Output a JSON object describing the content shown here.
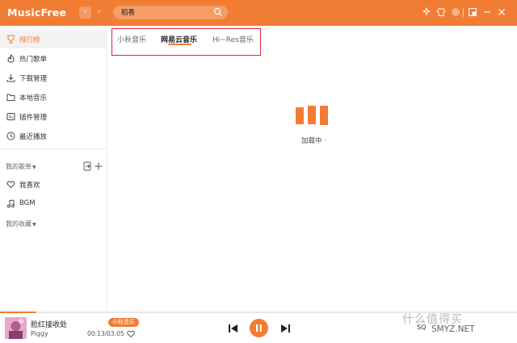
{
  "app": {
    "title": "MusicFree"
  },
  "search": {
    "value": "稻香"
  },
  "sidebar": {
    "items": [
      {
        "label": "排行榜",
        "icon": "trophy-icon",
        "active": true
      },
      {
        "label": "热门歌单",
        "icon": "fire-icon"
      },
      {
        "label": "下载管理",
        "icon": "download-icon"
      },
      {
        "label": "本地音乐",
        "icon": "folder-icon"
      },
      {
        "label": "插件管理",
        "icon": "plugin-icon"
      },
      {
        "label": "最近播放",
        "icon": "clock-icon"
      }
    ],
    "my_playlists_header": "我的歌单",
    "playlists": [
      {
        "label": "我喜欢",
        "icon": "heart-icon"
      },
      {
        "label": "BGM",
        "icon": "music-note-icon"
      }
    ],
    "my_favorites_header": "我的收藏"
  },
  "tabs": [
    {
      "label": "小秋音乐",
      "active": false
    },
    {
      "label": "网易云音乐",
      "active": true
    },
    {
      "label": "Hi~Res音乐",
      "active": false
    }
  ],
  "loading": {
    "text": "加载中 ·"
  },
  "player": {
    "title": "脸红接收处",
    "artist": "Piggy",
    "source": "小秋音乐",
    "time": "00:13/03:05",
    "progress": 0.07,
    "right_text": "SQ"
  },
  "watermark": {
    "text": "什么值得买",
    "url": "SMYZ.NET"
  },
  "colors": {
    "accent": "#f17d34",
    "highlight_box": "#d9232d"
  }
}
